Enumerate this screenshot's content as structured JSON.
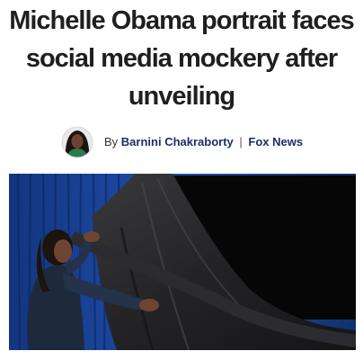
{
  "article": {
    "headline": "Michelle Obama portrait faces social media mockery after unveiling",
    "byline": {
      "prefix": "By",
      "author": "Barnini Chakraborty",
      "separator": "|",
      "outlet": "Fox News"
    },
    "photo": {
      "colors": {
        "curtain": "#1b3f9a",
        "cloth": "#2a2a2c",
        "background": "#080808"
      }
    }
  }
}
